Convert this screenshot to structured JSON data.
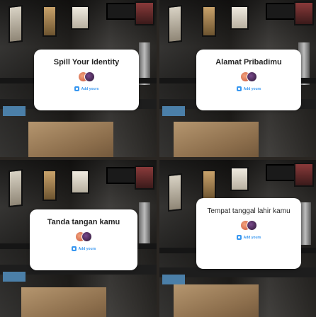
{
  "panels": [
    {
      "title": "Spill Your Identity",
      "add_label": "Add yours"
    },
    {
      "title": "Alamat Pribadimu",
      "add_label": "Add yours"
    },
    {
      "title": "Tanda tangan kamu",
      "add_label": "Add yours"
    },
    {
      "title": "Tempat tanggal lahir kamu",
      "add_label": "Add yours"
    }
  ],
  "colors": {
    "card": "#ffffff",
    "accent": "#3897f0",
    "text": "#262626"
  },
  "icons": [
    "avatar-stack-icon",
    "add-yours-icon"
  ]
}
